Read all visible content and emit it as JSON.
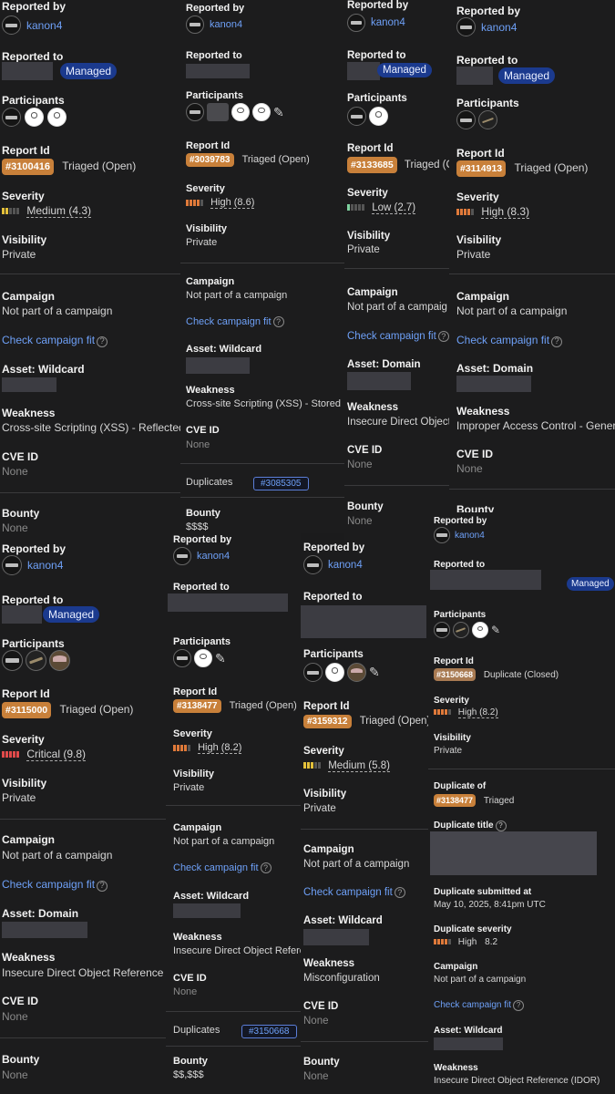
{
  "labels": {
    "reported_by": "Reported by",
    "reported_to": "Reported to",
    "participants": "Participants",
    "report_id": "Report Id",
    "severity": "Severity",
    "visibility": "Visibility",
    "campaign": "Campaign",
    "check_campaign": "Check campaign fit",
    "cve_id": "CVE ID",
    "weakness": "Weakness",
    "bounty": "Bounty",
    "duplicates": "Duplicates",
    "duplicate_of": "Duplicate of",
    "duplicate_title": "Duplicate title",
    "duplicate_submitted": "Duplicate submitted at",
    "duplicate_severity": "Duplicate severity"
  },
  "icons": {
    "edit": "pencil-icon",
    "info": "info-circle-icon",
    "avatar": "user-avatar-icon"
  },
  "colors": {
    "background": "#1b1b1c",
    "link": "#6ea0f7",
    "managed_pill": "#1b3a8e",
    "report_id_badge": "#c8803a",
    "sev_low": "#7fd3a0",
    "sev_medium": "#e3c03a",
    "sev_high": "#e07a3a",
    "sev_critical": "#e04a4a"
  },
  "panels": [
    {
      "reporter": "kanon4",
      "managed": "Managed",
      "report_id": "#3100416",
      "state": "Triaged (Open)",
      "severity": "Medium (4.3)",
      "visibility": "Private",
      "campaign": "Not part of a campaign",
      "asset_label": "Asset: Wildcard",
      "weakness": "Cross-site Scripting (XSS) - Reflected",
      "cve": "None",
      "bounty": "None"
    },
    {
      "reporter": "kanon4",
      "report_id": "#3039783",
      "state": "Triaged (Open)",
      "severity": "High (8.6)",
      "visibility": "Private",
      "campaign": "Not part of a campaign",
      "asset_label": "Asset: Wildcard",
      "weakness": "Cross-site Scripting (XSS) - Stored",
      "cve": "None",
      "duplicate_ref": "#3085305",
      "bounty": "$$$$"
    },
    {
      "reporter": "kanon4",
      "managed": "Managed",
      "report_id": "#3133685",
      "state": "Triaged (C",
      "severity": "Low (2.7)",
      "visibility": "Private",
      "campaign": "Not part of a campaig",
      "asset_label": "Asset: Domain",
      "weakness": "Insecure Direct Object",
      "cve": "None",
      "bounty": "None"
    },
    {
      "reporter": "kanon4",
      "managed": "Managed",
      "report_id": "#3114913",
      "state": "Triaged (Open)",
      "severity": "High (8.3)",
      "visibility": "Private",
      "campaign": "Not part of a campaign",
      "asset_label": "Asset: Domain",
      "weakness": "Improper Access Control - Generic",
      "cve": "None",
      "bounty": "Bounty"
    },
    {
      "reporter": "kanon4",
      "managed": "Managed",
      "report_id": "#3115000",
      "state": "Triaged (Open)",
      "severity": "Critical (9.8)",
      "visibility": "Private",
      "campaign": "Not part of a campaign",
      "asset_label": "Asset: Domain",
      "weakness": "Insecure Direct Object Reference (I",
      "cve": "None",
      "bounty": "None"
    },
    {
      "reporter": "kanon4",
      "report_id": "#3138477",
      "state": "Triaged (Open)",
      "severity": "High (8.2)",
      "visibility": "Private",
      "campaign": "Not part of a campaign",
      "asset_label": "Asset: Wildcard",
      "weakness": "Insecure Direct Object Refere",
      "cve": "None",
      "duplicate_ref": "#3150668",
      "bounty": "$$,$$$"
    },
    {
      "reporter": "kanon4",
      "report_id": "#3159312",
      "state": "Triaged (Open)",
      "severity": "Medium (5.8)",
      "visibility": "Private",
      "campaign": "Not part of a campaign",
      "asset_label": "Asset: Wildcard",
      "weakness": "Misconfiguration",
      "cve": "None",
      "bounty": "None"
    },
    {
      "reporter": "kanon4",
      "managed": "Managed",
      "report_id": "#3150668",
      "state": "Duplicate (Closed)",
      "severity": "High (8.2)",
      "visibility": "Private",
      "duplicate_of_id": "#3138477",
      "duplicate_of_state": "Triaged",
      "duplicate_submitted": "May 10, 2025, 8:41pm UTC",
      "duplicate_severity_label": "High",
      "duplicate_severity_score": "8.2",
      "campaign": "Not part of a campaign",
      "asset_label": "Asset: Wildcard",
      "weakness": "Insecure Direct Object Reference (IDOR)"
    }
  ]
}
